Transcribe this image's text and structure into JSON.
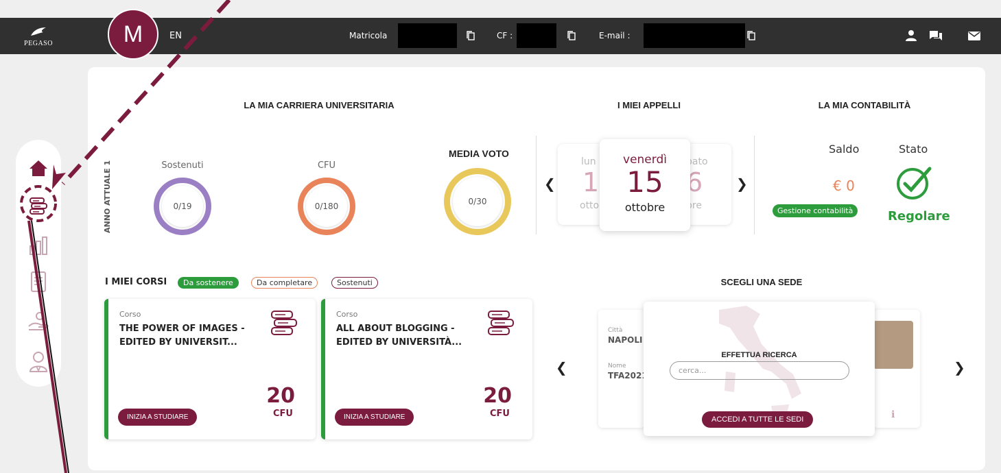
{
  "topbar": {
    "logo_text": "PEGASO",
    "avatar_initial": "M",
    "lang": "EN",
    "matricola_label": "Matricola",
    "cf_label": "CF :",
    "email_label": "E-mail :"
  },
  "sidebar": {
    "items": [
      {
        "name": "home"
      },
      {
        "name": "courses"
      },
      {
        "name": "stats"
      },
      {
        "name": "documents"
      },
      {
        "name": "payments"
      },
      {
        "name": "tutor"
      }
    ]
  },
  "carriera": {
    "title": "LA MIA CARRIERA UNIVERSITARIA",
    "anno_label": "ANNO ATTUALE 1",
    "sostenuti_label": "Sostenuti",
    "sostenuti_value": "0/19",
    "cfu_label": "CFU",
    "cfu_value": "0/180",
    "media_label": "MEDIA VOTO",
    "media_value": "0/30"
  },
  "appelli": {
    "title": "I MIEI APPELLI",
    "prev": "❮",
    "next": "❯",
    "left_day": "lun",
    "left_num": "18",
    "left_month": "otto",
    "right_day": "bato",
    "right_num": "6",
    "right_month": "bre",
    "day": "venerdì",
    "num": "15",
    "month": "ottobre"
  },
  "contabilita": {
    "title": "LA MIA CONTABILITÀ",
    "saldo_label": "Saldo",
    "stato_label": "Stato",
    "saldo_value": "€ 0",
    "gestione_label": "Gestione contabilità",
    "stato_value": "Regolare"
  },
  "corsi": {
    "title": "I MIEI CORSI",
    "filters": [
      "Da sostenere",
      "Da completare",
      "Sostenuti"
    ],
    "items": [
      {
        "small": "Corso",
        "title": "THE POWER OF IMAGES - EDITED BY UNIVERSIT...",
        "cfu": "20",
        "cfu_label": "CFU",
        "btn": "INIZIA A STUDIARE"
      },
      {
        "small": "Corso",
        "title": "ALL ABOUT BLOGGING - EDITED BY UNIVERSITÀ...",
        "cfu": "20",
        "cfu_label": "CFU",
        "btn": "INIZIA A STUDIARE"
      }
    ]
  },
  "sede": {
    "title": "SCEGLI UNA SEDE",
    "prev": "❮",
    "next": "❯",
    "citta_label": "Città",
    "citta_value": "NAPOLI",
    "nome_label": "Nome",
    "nome_value": "TFA2021",
    "search_title": "EFFETTUA RICERCA",
    "search_placeholder": "cerca...",
    "btn": "ACCEDI A TUTTE LE SEDI"
  },
  "colors": {
    "brand": "#7b1c3e",
    "green": "#2d9c3c",
    "orange": "#e9835a",
    "purple": "#9b7fc4",
    "yellow": "#e8c85a"
  }
}
